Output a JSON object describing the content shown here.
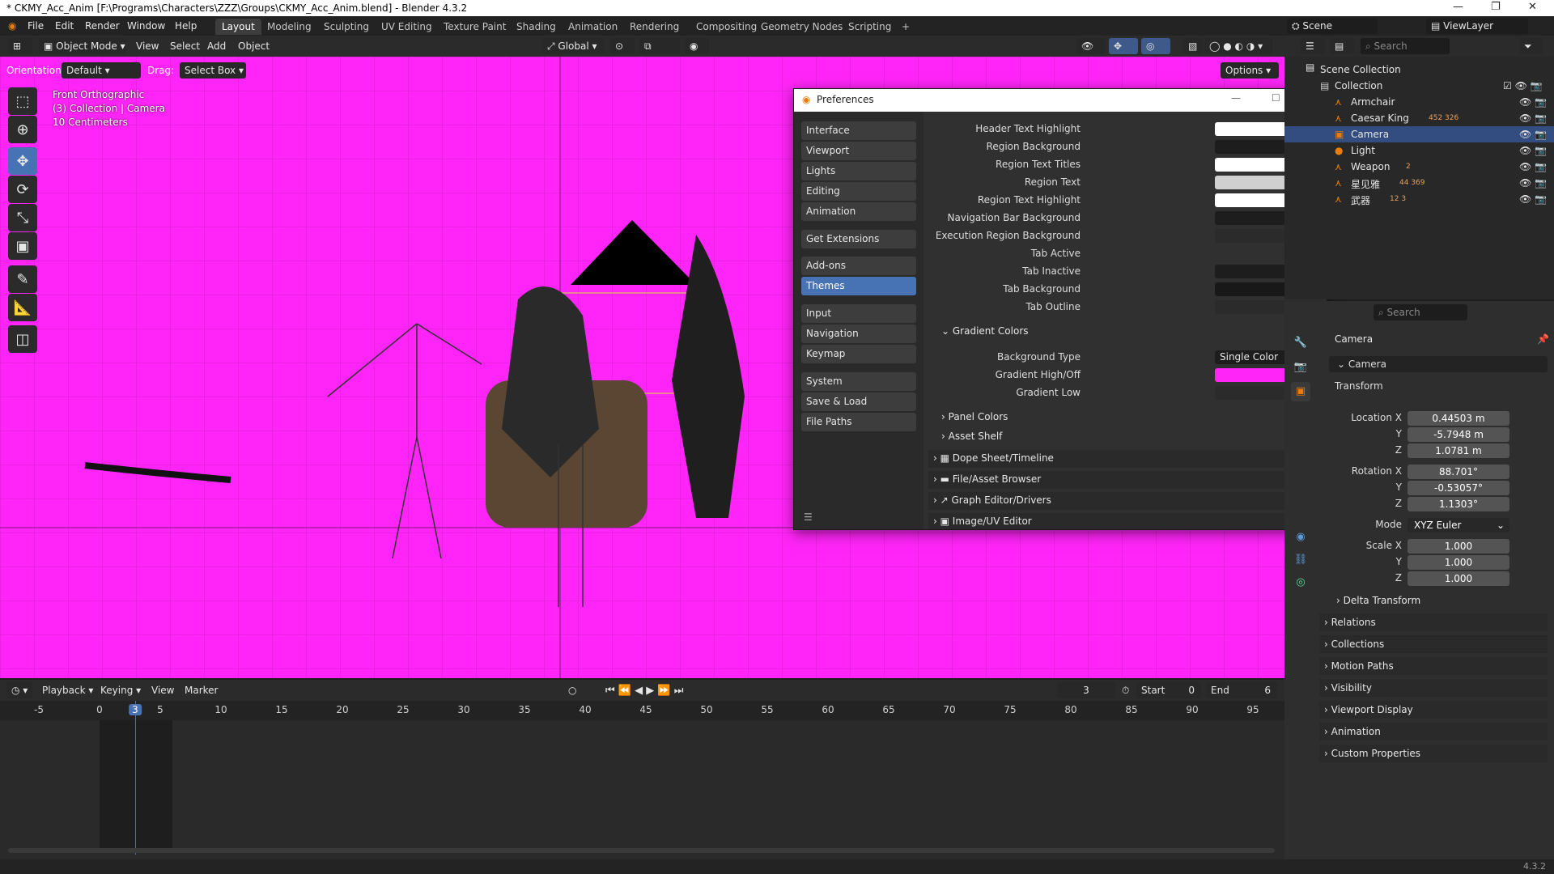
{
  "window": {
    "title": "* CKMY_Acc_Anim [F:\\Programs\\Characters\\ZZZ\\Groups\\CKMY_Acc_Anim.blend] - Blender 4.3.2",
    "controls": [
      "—",
      "❐",
      "✕"
    ]
  },
  "menu": [
    "File",
    "Edit",
    "Render",
    "Window",
    "Help"
  ],
  "workspaces": [
    "Layout",
    "Modeling",
    "Sculpting",
    "UV Editing",
    "Texture Paint",
    "Shading",
    "Animation",
    "Rendering",
    "Compositing",
    "Geometry Nodes",
    "Scripting",
    "+"
  ],
  "active_workspace": "Layout",
  "scene": {
    "scene_name": "Scene",
    "view_layer": "ViewLayer"
  },
  "viewport_header": {
    "mode": "Object Mode",
    "menus": [
      "View",
      "Select",
      "Add",
      "Object"
    ],
    "transform_orientation": "Global",
    "orientation_label": "Orientation:",
    "orientation_value": "Default",
    "drag_label": "Drag:",
    "drag_value": "Select Box",
    "options": "Options"
  },
  "viewport_info": {
    "view": "Front Orthographic",
    "collection": "(3) Collection | Camera",
    "scale": "10 Centimeters"
  },
  "preferences": {
    "title": "Preferences",
    "categories": [
      {
        "label": "Interface"
      },
      {
        "label": "Viewport"
      },
      {
        "label": "Lights"
      },
      {
        "label": "Editing"
      },
      {
        "label": "Animation"
      },
      {
        "label": "Get Extensions"
      },
      {
        "label": "Add-ons"
      },
      {
        "label": "Themes"
      },
      {
        "label": "Input"
      },
      {
        "label": "Navigation"
      },
      {
        "label": "Keymap"
      },
      {
        "label": "System"
      },
      {
        "label": "Save & Load"
      },
      {
        "label": "File Paths"
      }
    ],
    "active_category": "Themes",
    "theme_rows": [
      {
        "label": "Header Text Highlight",
        "color": "#ffffff"
      },
      {
        "label": "Region Background",
        "color": "checker"
      },
      {
        "label": "Region Text Titles",
        "color": "#ffffff"
      },
      {
        "label": "Region Text",
        "color": "#d0d0d0"
      },
      {
        "label": "Region Text Highlight",
        "color": "#ffffff"
      },
      {
        "label": "Navigation Bar Background",
        "color": "#1d1d1d"
      },
      {
        "label": "Execution Region Background",
        "color": "#2b2b2b"
      },
      {
        "label": "Tab Active",
        "color": "#303030"
      },
      {
        "label": "Tab Inactive",
        "color": "#1d1d1d"
      },
      {
        "label": "Tab Background",
        "color": "#181818"
      },
      {
        "label": "Tab Outline",
        "color": "#2b2b2b"
      }
    ],
    "gradient_section": "Gradient Colors",
    "background_type_label": "Background Type",
    "background_type_value": "Single Color",
    "gradient_high_label": "Gradient High/Off",
    "gradient_high_color": "#ff25f8",
    "gradient_low_label": "Gradient Low",
    "gradient_low_color": "#2b2b2b",
    "subsections": [
      "Panel Colors",
      "Asset Shelf"
    ],
    "editors": [
      "Dope Sheet/Timeline",
      "File/Asset Browser",
      "Graph Editor/Drivers",
      "Image/UV Editor"
    ]
  },
  "outliner": {
    "search_placeholder": "Search",
    "root": "Scene Collection",
    "collection": "Collection",
    "items": [
      {
        "name": "Armchair"
      },
      {
        "name": "Caesar King",
        "extra": "452 326"
      },
      {
        "name": "Camera"
      },
      {
        "name": "Light"
      },
      {
        "name": "Weapon",
        "extra": "2"
      },
      {
        "name": "星见雅",
        "extra": "44 369"
      },
      {
        "name": "武器",
        "extra": "12 3"
      }
    ],
    "selected": "Camera"
  },
  "properties": {
    "search_placeholder": "Search",
    "object_name": "Camera",
    "datablock": "Camera",
    "transform_label": "Transform",
    "location": {
      "label": "Location X",
      "x": "0.44503 m",
      "y": "-5.7948 m",
      "z": "1.0781 m"
    },
    "rotation": {
      "label": "Rotation X",
      "x": "88.701°",
      "y": "-0.53057°",
      "z": "1.1303°"
    },
    "mode_label": "Mode",
    "mode_value": "XYZ Euler",
    "scale": {
      "label": "Scale X",
      "x": "1.000",
      "y": "1.000",
      "z": "1.000"
    },
    "axis_y": "Y",
    "axis_z": "Z",
    "delta": "Delta Transform",
    "panels": [
      "Relations",
      "Collections",
      "Motion Paths",
      "Visibility",
      "Viewport Display",
      "Animation",
      "Custom Properties"
    ]
  },
  "timeline": {
    "menus": [
      "Playback",
      "Keying",
      "View",
      "Marker"
    ],
    "current_frame": "3",
    "start_label": "Start",
    "start_value": "0",
    "end_label": "End",
    "end_value": "6",
    "ticks": [
      "-5",
      "0",
      "3",
      "5",
      "10",
      "15",
      "20",
      "25",
      "30",
      "35",
      "40",
      "45",
      "50",
      "55",
      "60",
      "65",
      "70",
      "75",
      "80",
      "85",
      "90",
      "95"
    ]
  },
  "status": {
    "version": "4.3.2"
  },
  "colors": {
    "viewport_bg": "#ff25f8",
    "accent": "#4772b3",
    "selected_row": "#334d80"
  }
}
